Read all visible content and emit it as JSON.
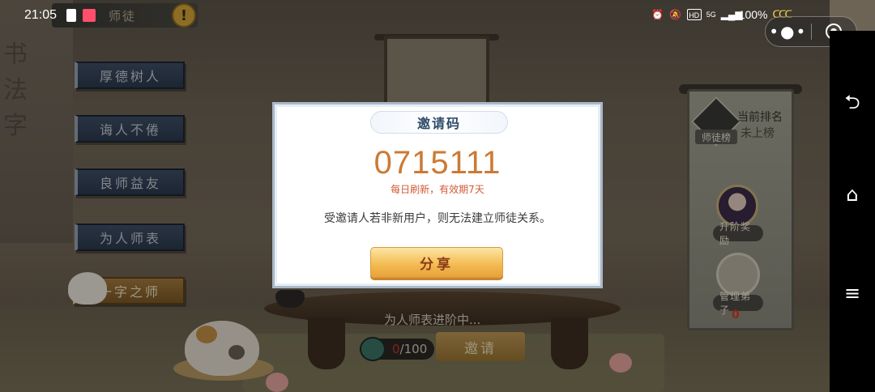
{
  "status_bar": {
    "time": "21:05",
    "battery_percent": "100%",
    "network": "5G"
  },
  "game": {
    "tab_title": "师徒",
    "plaques": [
      "厚德树人",
      "诲人不倦",
      "良师益友",
      "为人师表",
      "一字之师"
    ],
    "rank": {
      "icon_label": "师徒榜",
      "label": "当前排名",
      "value": "未上榜"
    },
    "reward_label": "升阶奖励",
    "manage_label": "管理弟子",
    "manage_count": "0",
    "progress_text": "为人师表进阶中...",
    "progress_current": "0",
    "progress_total": "/100",
    "invite_button": "邀请"
  },
  "dialog": {
    "title": "邀请码",
    "code": "0715111",
    "hint": "每日刷新，有效期7天",
    "notice": "受邀请人若非新用户，则无法建立师徒关系。",
    "share_button": "分享"
  },
  "capsule": {
    "more": "•●•"
  },
  "nav": {
    "back": "⮌",
    "home": "⌂",
    "menu": "≡"
  }
}
